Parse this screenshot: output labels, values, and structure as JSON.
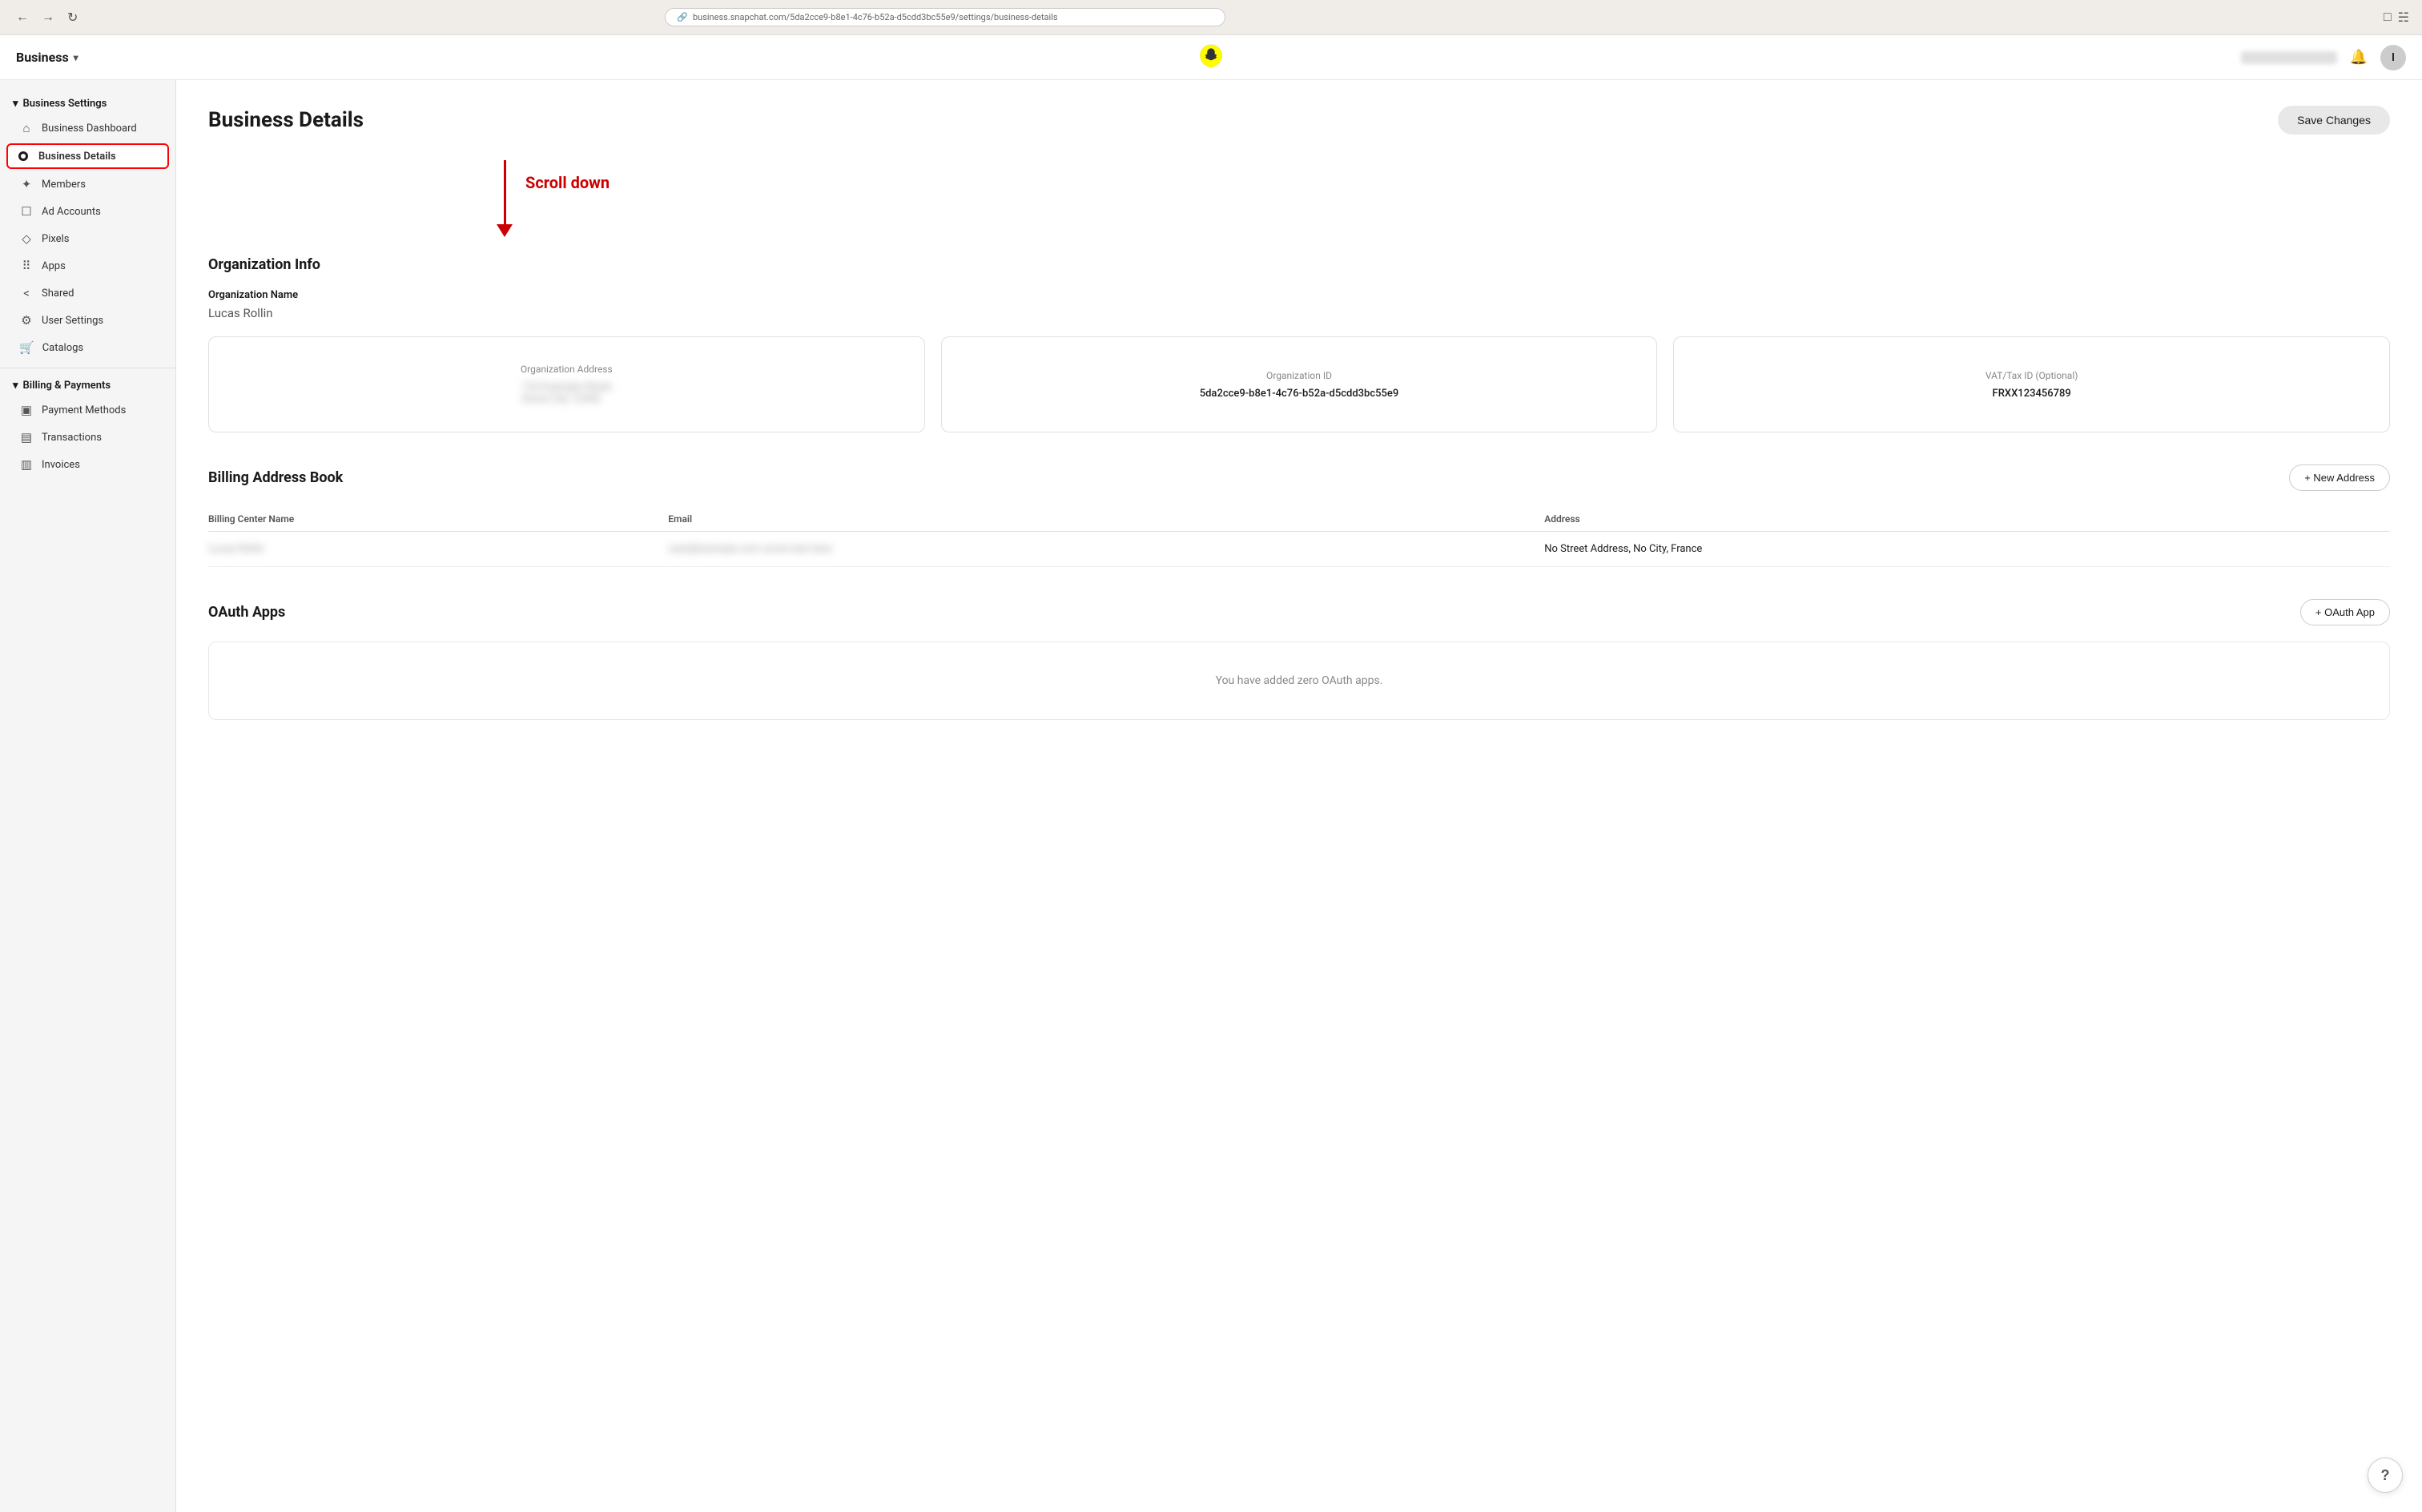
{
  "browser": {
    "url": "business.snapchat.com/5da2cce9-b8e1-4c76-b52a-d5cdd3bc55e9/settings/business-details",
    "back_btn": "←",
    "forward_btn": "→",
    "refresh_btn": "↻"
  },
  "header": {
    "business_label": "Business",
    "chevron": "▾",
    "notification_icon": "🔔",
    "user_initial": "I"
  },
  "sidebar": {
    "section_label": "Business Settings",
    "items": [
      {
        "id": "business-dashboard",
        "label": "Business Dashboard",
        "icon": "⌂"
      },
      {
        "id": "business-details",
        "label": "Business Details",
        "icon": "●",
        "active": true
      },
      {
        "id": "members",
        "label": "Members",
        "icon": "✦"
      },
      {
        "id": "ad-accounts",
        "label": "Ad Accounts",
        "icon": "☐"
      },
      {
        "id": "pixels",
        "label": "Pixels",
        "icon": "◇"
      },
      {
        "id": "apps",
        "label": "Apps",
        "icon": "⠿"
      },
      {
        "id": "shared",
        "label": "Shared",
        "icon": "⟨"
      },
      {
        "id": "user-settings",
        "label": "User Settings",
        "icon": "⚙"
      },
      {
        "id": "catalogs",
        "label": "Catalogs",
        "icon": "🛒"
      }
    ],
    "billing_section_label": "Billing & Payments",
    "billing_items": [
      {
        "id": "payment-methods",
        "label": "Payment Methods",
        "icon": "▣"
      },
      {
        "id": "transactions",
        "label": "Transactions",
        "icon": "▤"
      },
      {
        "id": "invoices",
        "label": "Invoices",
        "icon": "▥"
      }
    ]
  },
  "main": {
    "page_title": "Business Details",
    "save_btn_label": "Save Changes",
    "scroll_down_label": "Scroll down",
    "org_info": {
      "section_title": "Organization Info",
      "name_label": "Organization Name",
      "name_value": "Lucas Rollin",
      "address_card_label": "Organization Address",
      "id_card_label": "Organization ID",
      "id_card_value": "5da2cce9-b8e1-4c76-b52a-d5cdd3bc55e9",
      "vat_card_label": "VAT/Tax ID (Optional)",
      "vat_card_value": "FRXX123456789"
    },
    "billing_address": {
      "section_title": "Billing Address Book",
      "new_address_btn": "+ New Address",
      "table_headers": [
        "Billing Center Name",
        "Email",
        "Address"
      ],
      "table_rows": [
        {
          "name_blurred": true,
          "email_blurred": true,
          "address": "No Street Address, No City, France"
        }
      ]
    },
    "oauth": {
      "section_title": "OAuth Apps",
      "oauth_btn": "+ OAuth App",
      "empty_state": "You have added zero OAuth apps."
    }
  }
}
